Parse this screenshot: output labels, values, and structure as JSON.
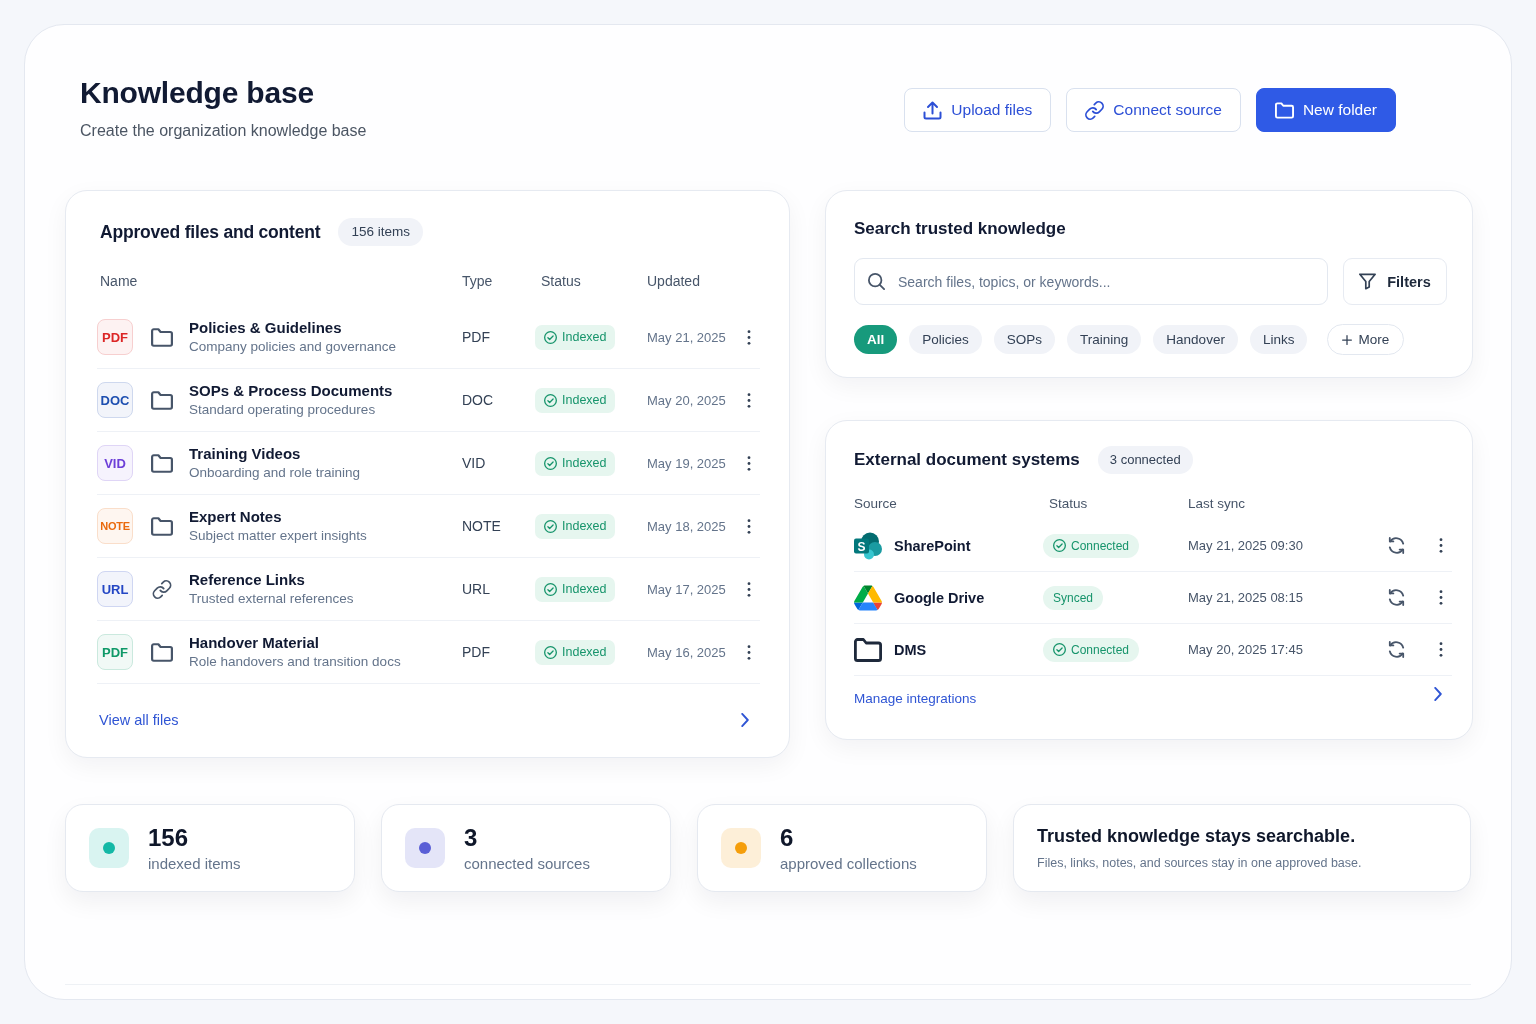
{
  "header": {
    "title": "Knowledge base",
    "subtitle": "Create the organization knowledge base",
    "actions": [
      {
        "label": "Upload files",
        "kind": "upload",
        "primary": false
      },
      {
        "label": "Connect source",
        "kind": "connect",
        "primary": false
      },
      {
        "label": "New folder",
        "kind": "folder",
        "primary": true
      }
    ]
  },
  "files": {
    "title": "Approved files and content",
    "count": "156 items",
    "columns": [
      "Name",
      "Type",
      "Status",
      "Updated"
    ],
    "rows": [
      {
        "tag": "PDF",
        "color": "#dc2626",
        "kind": "folder",
        "name": "Policies & Guidelines",
        "description": "Company policies and governance",
        "type": "PDF",
        "status": "Indexed",
        "status_icon": true,
        "updated": "May 21, 2025"
      },
      {
        "tag": "DOC",
        "color": "#1e4fb0",
        "kind": "folder",
        "name": "SOPs & Process Documents",
        "description": "Standard operating procedures",
        "type": "DOC",
        "status": "Indexed",
        "status_icon": true,
        "updated": "May 20, 2025"
      },
      {
        "tag": "VID",
        "color": "#6d3fd8",
        "kind": "folder",
        "name": "Training Videos",
        "description": "Onboarding and role training",
        "type": "VID",
        "status": "Indexed",
        "status_icon": true,
        "updated": "May 19, 2025"
      },
      {
        "tag": "NOTE",
        "color": "#ea6a0c",
        "kind": "folder",
        "name": "Expert Notes",
        "description": "Subject matter expert insights",
        "type": "NOTE",
        "status": "Indexed",
        "status_icon": true,
        "updated": "May 18, 2025"
      },
      {
        "tag": "URL",
        "color": "#2346c4",
        "kind": "link",
        "name": "Reference Links",
        "description": "Trusted external references",
        "type": "URL",
        "status": "Indexed",
        "status_icon": true,
        "updated": "May 17, 2025"
      },
      {
        "tag": "PDF",
        "color": "#0f9968",
        "kind": "folder",
        "name": "Handover Material",
        "description": "Role handovers and transition docs",
        "type": "PDF",
        "status": "Indexed",
        "status_icon": true,
        "updated": "May 16, 2025"
      }
    ],
    "footer_link": "View all files"
  },
  "search": {
    "title": "Search trusted knowledge",
    "placeholder": "Search files, topics, or keywords...",
    "filters_button": "Filters",
    "chips": [
      {
        "label": "All",
        "selected": true
      },
      {
        "label": "Policies",
        "selected": false
      },
      {
        "label": "SOPs",
        "selected": false
      },
      {
        "label": "Training",
        "selected": false
      },
      {
        "label": "Handover",
        "selected": false
      },
      {
        "label": "Links",
        "selected": false
      }
    ],
    "more_button": "More"
  },
  "sources": {
    "title": "External document systems",
    "count": "3 connected",
    "columns": [
      "Source",
      "Status",
      "Last sync"
    ],
    "rows": [
      {
        "kind": "sharepoint",
        "logo_letter": "S",
        "name": "SharePoint",
        "status": "Connected",
        "status_icon": true,
        "last_sync": "May 21, 2025 09:30"
      },
      {
        "kind": "gdrive",
        "name": "Google Drive",
        "status": "Synced",
        "status_icon": false,
        "last_sync": "May 21, 2025 08:15"
      },
      {
        "kind": "folder",
        "name": "DMS",
        "status": "Connected",
        "status_icon": true,
        "last_sync": "May 20, 2025 17:45"
      }
    ],
    "footer_link": "Manage integrations"
  },
  "stats": [
    {
      "value": "156",
      "label": "indexed items",
      "color": "#14b8a6"
    },
    {
      "value": "3",
      "label": "connected sources",
      "color": "#5a5fd6"
    },
    {
      "value": "6",
      "label": "approved collections",
      "color": "#f59e0b"
    }
  ],
  "note": {
    "title": "Trusted knowledge stays searchable.",
    "text": "Files, links, notes, and sources stay in one approved base."
  }
}
